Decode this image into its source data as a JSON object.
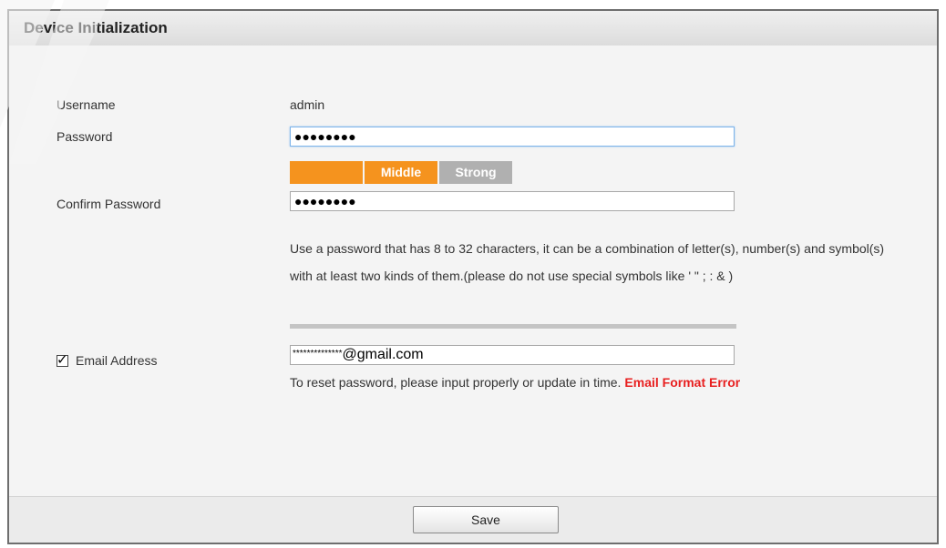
{
  "dialog": {
    "title": "Device Initialization"
  },
  "form": {
    "username_label": "Username",
    "username_value": "admin",
    "password_label": "Password",
    "password_value": "●●●●●●●●",
    "strength": {
      "weak_label": "",
      "middle_label": "Middle",
      "strong_label": "Strong",
      "level": "Middle"
    },
    "confirm_label": "Confirm Password",
    "confirm_value": "●●●●●●●●",
    "hint_text": "Use a password that has 8 to 32 characters, it can be a combination of letter(s), number(s) and symbol(s) with at least two kinds of them.(please do not use special symbols like ' \" ; : & )",
    "email_checkbox_checked": true,
    "email_label": "Email Address",
    "email_value_masked": "**************",
    "email_value_domain": "@gmail.com",
    "email_note": "To reset password, please input properly or update in time.",
    "email_error": "Email Format Error"
  },
  "footer": {
    "save_label": "Save"
  },
  "colors": {
    "strength_active": "#f5931e",
    "strength_inactive": "#b0b0b0",
    "error": "#e81f1f",
    "focus_border": "#7eb4ea"
  }
}
